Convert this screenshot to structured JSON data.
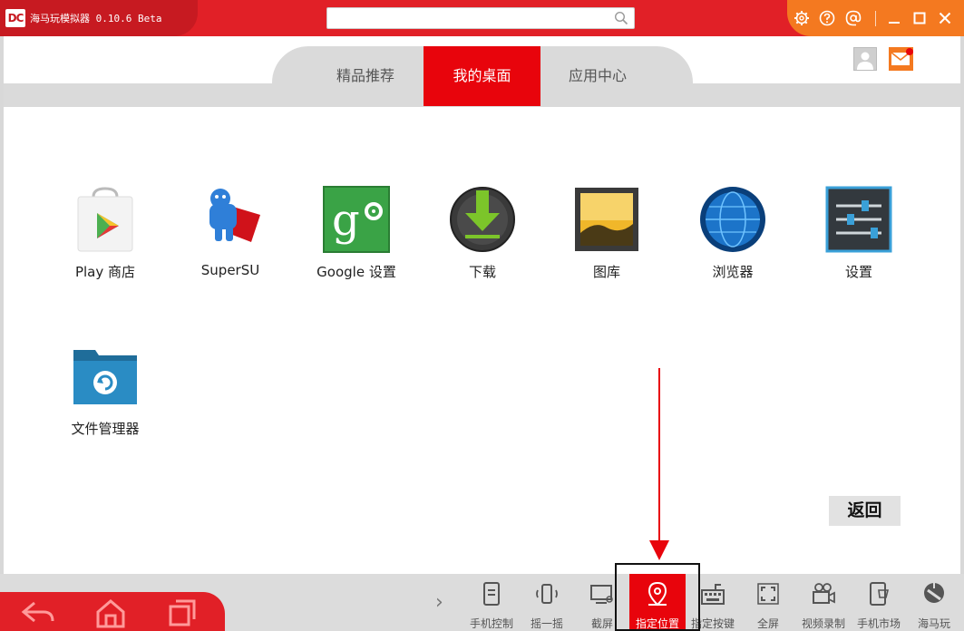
{
  "titlebar": {
    "app_title": "海马玩模拟器 0.10.6 Beta",
    "search_placeholder": "",
    "search_value": ""
  },
  "tabs": [
    {
      "label": "精品推荐",
      "active": false
    },
    {
      "label": "我的桌面",
      "active": true
    },
    {
      "label": "应用中心",
      "active": false
    }
  ],
  "apps": [
    {
      "label": "Play 商店",
      "icon": "play-store-icon"
    },
    {
      "label": "SuperSU",
      "icon": "supersu-icon"
    },
    {
      "label": "Google 设置",
      "icon": "google-settings-icon"
    },
    {
      "label": "下载",
      "icon": "download-icon"
    },
    {
      "label": "图库",
      "icon": "gallery-icon"
    },
    {
      "label": "浏览器",
      "icon": "browser-globe-icon"
    },
    {
      "label": "设置",
      "icon": "settings-sliders-icon"
    },
    {
      "label": "文件管理器",
      "icon": "file-manager-icon"
    }
  ],
  "back_button": "返回",
  "toolbar": [
    {
      "label": "手机控制",
      "icon": "phone-control-icon"
    },
    {
      "label": "摇一摇",
      "icon": "shake-icon"
    },
    {
      "label": "截屏",
      "icon": "screenshot-icon"
    },
    {
      "label": "指定位置",
      "icon": "location-pin-icon",
      "active": true
    },
    {
      "label": "指定按键",
      "icon": "keyboard-icon"
    },
    {
      "label": "全屏",
      "icon": "fullscreen-icon"
    },
    {
      "label": "视频录制",
      "icon": "video-record-icon"
    },
    {
      "label": "手机市场",
      "icon": "phone-market-icon"
    },
    {
      "label": "海马玩",
      "icon": "haimawan-icon"
    }
  ],
  "colors": {
    "brand_red": "#e12027",
    "active_red": "#e8040c",
    "accent_orange": "#f47920",
    "toolbar_gray": "#dcdcdc"
  }
}
